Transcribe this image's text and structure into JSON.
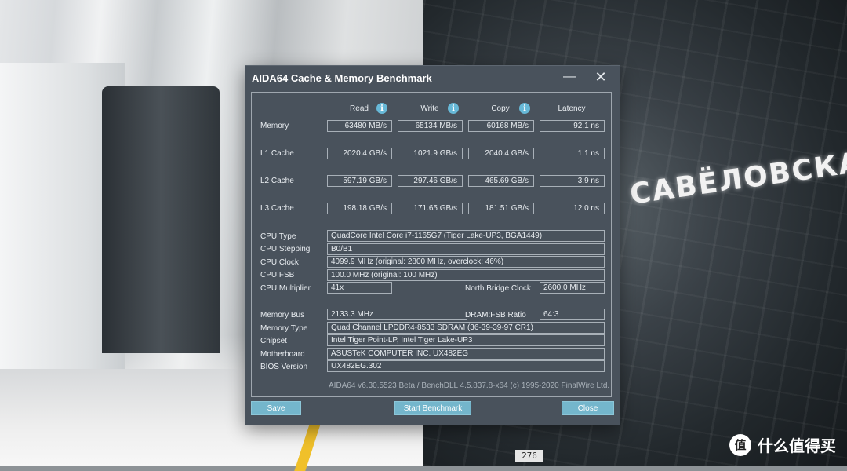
{
  "window": {
    "title": "AIDA64 Cache & Memory Benchmark",
    "minimize_glyph": "—",
    "close_glyph": "✕"
  },
  "columns": {
    "read": "Read",
    "write": "Write",
    "copy": "Copy",
    "latency": "Latency",
    "info_glyph": "i"
  },
  "bench": {
    "memory": {
      "label": "Memory",
      "read": "63480 MB/s",
      "write": "65134 MB/s",
      "copy": "60168 MB/s",
      "latency": "92.1 ns"
    },
    "l1": {
      "label": "L1 Cache",
      "read": "2020.4 GB/s",
      "write": "1021.9 GB/s",
      "copy": "2040.4 GB/s",
      "latency": "1.1 ns"
    },
    "l2": {
      "label": "L2 Cache",
      "read": "597.19 GB/s",
      "write": "297.46 GB/s",
      "copy": "465.69 GB/s",
      "latency": "3.9 ns"
    },
    "l3": {
      "label": "L3 Cache",
      "read": "198.18 GB/s",
      "write": "171.65 GB/s",
      "copy": "181.51 GB/s",
      "latency": "12.0 ns"
    }
  },
  "info": {
    "cpu_type": {
      "label": "CPU Type",
      "value": "QuadCore Intel Core i7-1165G7  (Tiger Lake-UP3, BGA1449)"
    },
    "cpu_stepping": {
      "label": "CPU Stepping",
      "value": "B0/B1"
    },
    "cpu_clock": {
      "label": "CPU Clock",
      "value": "4099.9 MHz  (original: 2800 MHz, overclock: 46%)"
    },
    "cpu_fsb": {
      "label": "CPU FSB",
      "value": "100.0 MHz  (original: 100 MHz)"
    },
    "cpu_multiplier": {
      "label": "CPU Multiplier",
      "value": "41x"
    },
    "nb_clock": {
      "label": "North Bridge Clock",
      "value": "2600.0 MHz"
    },
    "memory_bus": {
      "label": "Memory Bus",
      "value": "2133.3 MHz"
    },
    "dram_fsb": {
      "label": "DRAM:FSB Ratio",
      "value": "64:3"
    },
    "memory_type": {
      "label": "Memory Type",
      "value": "Quad Channel LPDDR4-8533 SDRAM  (36-39-39-97 CR1)"
    },
    "chipset": {
      "label": "Chipset",
      "value": "Intel Tiger Point-LP, Intel Tiger Lake-UP3"
    },
    "motherboard": {
      "label": "Motherboard",
      "value": "ASUSTeK COMPUTER INC. UX482EG"
    },
    "bios_version": {
      "label": "BIOS Version",
      "value": "UX482EG.302"
    }
  },
  "footer": "AIDA64 v6.30.5523 Beta / BenchDLL 4.5.837.8-x64  (c) 1995-2020 FinalWire Ltd.",
  "buttons": {
    "save": "Save",
    "start": "Start Benchmark",
    "close": "Close"
  },
  "background": {
    "station_name": "САВЁЛОВСКАЯ",
    "track_plate": "276",
    "watermark_logo": "值",
    "watermark_text": "什么值得买"
  },
  "colors": {
    "window_bg": "#49525c",
    "button_bg": "#74b6cc",
    "info_icon": "#67b9d8"
  }
}
